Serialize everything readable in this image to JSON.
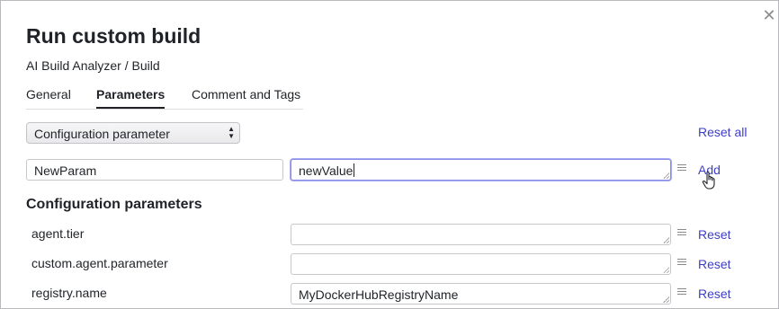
{
  "dialog": {
    "title": "Run custom build",
    "subtitle": "AI Build Analyzer / Build",
    "close_icon": "close-icon"
  },
  "tabs": [
    {
      "label": "General",
      "active": false
    },
    {
      "label": "Parameters",
      "active": true
    },
    {
      "label": "Comment and Tags",
      "active": false
    }
  ],
  "parameter_type_select": {
    "value": "Configuration parameter"
  },
  "reset_all_label": "Reset all",
  "new_param": {
    "name": "NewParam",
    "value": "newValue",
    "add_label": "Add"
  },
  "section_title": "Configuration parameters",
  "parameters": [
    {
      "name": "agent.tier",
      "value": "",
      "reset_label": "Reset"
    },
    {
      "name": "custom.agent.parameter",
      "value": "",
      "reset_label": "Reset"
    },
    {
      "name": "registry.name",
      "value": "MyDockerHubRegistryName",
      "reset_label": "Reset"
    }
  ],
  "colors": {
    "link": "#3d3dc8",
    "focus_border": "#8b8ee8"
  }
}
